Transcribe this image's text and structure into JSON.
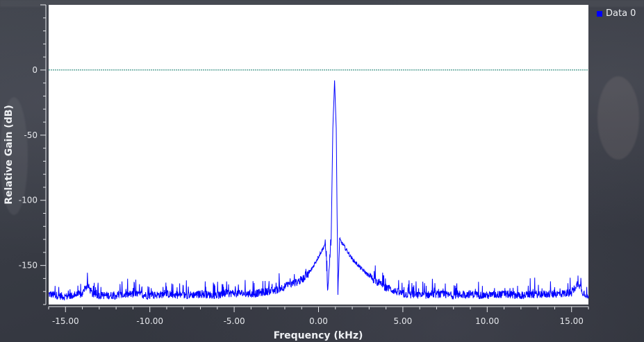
{
  "chart_data": {
    "type": "line",
    "xlabel": "Frequency (kHz)",
    "ylabel": "Relative Gain (dB)",
    "xlim": [
      -16.0,
      16.0
    ],
    "ylim": [
      -180,
      50
    ],
    "x_ticks": [
      {
        "value": -15,
        "label": "-15.00"
      },
      {
        "value": -10,
        "label": "-10.00"
      },
      {
        "value": -5,
        "label": "-5.00"
      },
      {
        "value": 0,
        "label": "0.00"
      },
      {
        "value": 5,
        "label": "5.00"
      },
      {
        "value": 10,
        "label": "10.00"
      },
      {
        "value": 15,
        "label": "15.00"
      }
    ],
    "y_ticks": [
      {
        "value": 0,
        "label": "0"
      },
      {
        "value": -50,
        "label": "-50"
      },
      {
        "value": -100,
        "label": "-100"
      },
      {
        "value": -150,
        "label": "-150"
      }
    ],
    "reference_line": {
      "y": 0,
      "color": "#0e7a6a"
    },
    "grid": false,
    "legend_position": "top-right",
    "series": [
      {
        "name": "Data 0",
        "color": "#0000ff",
        "x": [
          -16.0,
          -15.0,
          -14.0,
          -13.7,
          -13.4,
          -13.0,
          -12.0,
          -11.0,
          -10.0,
          -9.0,
          -8.0,
          -7.0,
          -6.0,
          -5.0,
          -4.0,
          -3.0,
          -2.5,
          -2.0,
          -1.5,
          -1.0,
          -0.5,
          -0.2,
          0.05,
          0.3,
          0.4,
          0.55,
          0.75,
          0.85,
          0.95,
          1.05,
          1.15,
          1.25,
          1.4,
          1.6,
          2.0,
          2.5,
          3.0,
          3.5,
          4.0,
          5.0,
          6.0,
          7.0,
          8.0,
          9.0,
          10.0,
          11.0,
          12.0,
          13.0,
          14.0,
          15.0,
          15.4,
          15.6,
          16.0
        ],
        "y": [
          -172,
          -174,
          -172,
          -165,
          -172,
          -173,
          -173,
          -172,
          -173,
          -172,
          -173,
          -172,
          -173,
          -171,
          -172,
          -170,
          -169,
          -166,
          -164,
          -161,
          -155,
          -148,
          -142,
          -136,
          -133,
          -170,
          -130,
          -45,
          -8,
          -45,
          -172,
          -130,
          -133,
          -137,
          -145,
          -152,
          -158,
          -163,
          -167,
          -172,
          -173,
          -172,
          -173,
          -172,
          -173,
          -172,
          -173,
          -172,
          -172,
          -171,
          -163,
          -170,
          -173
        ]
      }
    ]
  }
}
